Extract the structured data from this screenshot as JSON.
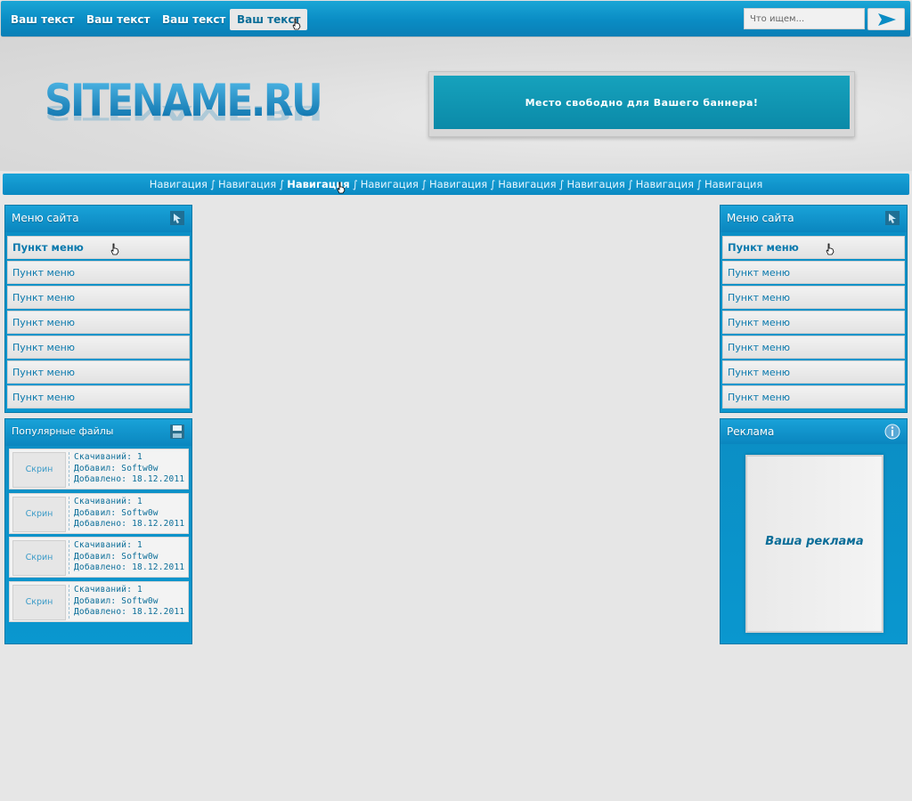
{
  "topnav": {
    "links": [
      "Ваш текст",
      "Ваш текст",
      "Ваш текст",
      "Ваш текст"
    ],
    "search_placeholder": "Что ищем..."
  },
  "header": {
    "logo": "SITENAME.RU",
    "banner_text": "Место свободно для Вашего баннера!"
  },
  "nav": {
    "items": [
      "Навигация",
      "Навигация",
      "Навигация",
      "Навигация",
      "Навигация",
      "Навигация",
      "Навигация",
      "Навигация",
      "Навигация"
    ],
    "separator": "∫"
  },
  "left_menu": {
    "title": "Меню сайта",
    "items": [
      "Пункт меню",
      "Пункт меню",
      "Пункт меню",
      "Пункт меню",
      "Пункт меню",
      "Пункт меню",
      "Пункт меню"
    ]
  },
  "right_menu": {
    "title": "Меню сайта",
    "items": [
      "Пункт меню",
      "Пункт меню",
      "Пункт меню",
      "Пункт меню",
      "Пункт меню",
      "Пункт меню",
      "Пункт меню"
    ]
  },
  "popular_files": {
    "title": "Популярные файлы",
    "items": [
      {
        "thumb": "Скрин",
        "downloads": "Скачиваний: 1",
        "added_by": "Добавил: Softw0w",
        "date": "Добавлено: 18.12.2011"
      },
      {
        "thumb": "Скрин",
        "downloads": "Скачиваний: 1",
        "added_by": "Добавил: Softw0w",
        "date": "Добавлено: 18.12.2011"
      },
      {
        "thumb": "Скрин",
        "downloads": "Скачиваний: 1",
        "added_by": "Добавил: Softw0w",
        "date": "Добавлено: 18.12.2011"
      },
      {
        "thumb": "Скрин",
        "downloads": "Скачиваний: 1",
        "added_by": "Добавил: Softw0w",
        "date": "Добавлено: 18.12.2011"
      }
    ]
  },
  "ads": {
    "title": "Реклама",
    "text": "Ваша реклама"
  }
}
